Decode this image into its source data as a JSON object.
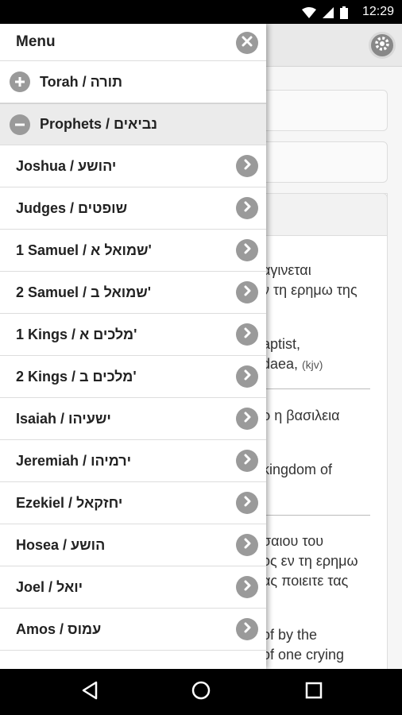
{
  "status_bar": {
    "time": "12:29"
  },
  "drawer": {
    "title": "Menu",
    "groups": [
      {
        "label": "Torah / תורה",
        "expanded": false
      },
      {
        "label": "Prophets / נביאים",
        "expanded": true
      }
    ],
    "books": [
      {
        "label": "Joshua / יהושע"
      },
      {
        "label": "Judges / שופטים"
      },
      {
        "label": "1 Samuel / שמואל א'"
      },
      {
        "label": "2 Samuel / שמואל ב'"
      },
      {
        "label": "1 Kings / מלכים א'"
      },
      {
        "label": "2 Kings / מלכים ב'"
      },
      {
        "label": "Isaiah / ישעיהו"
      },
      {
        "label": "Jeremiah / ירמיהו"
      },
      {
        "label": "Ezekiel / יחזקאל"
      },
      {
        "label": "Hosea / הושע"
      },
      {
        "label": "Joel / יואל"
      },
      {
        "label": "Amos / עמוס"
      }
    ]
  },
  "background": {
    "lines": [
      "αγινεται",
      "ν τη ερημω της",
      "aptist,",
      "daea,",
      "(kjv)",
      "ρ η βασιλεια",
      "kingdom of",
      "σαιου του",
      "ος εν τη ερημω",
      "ας ποιειτε τας",
      "of by the",
      "of one crying"
    ]
  }
}
